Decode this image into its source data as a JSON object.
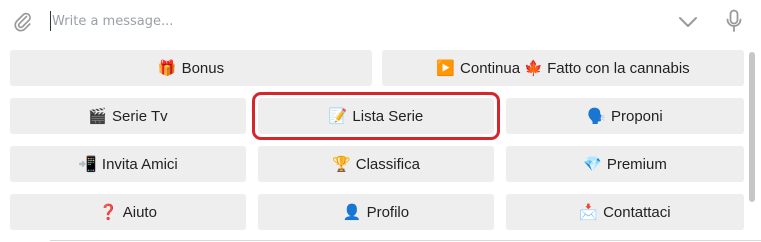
{
  "composer": {
    "placeholder": "Write a message...",
    "value": "",
    "attach_icon": "paperclip-icon",
    "collapse_icon": "chevron-down-icon",
    "mic_icon": "microphone-icon"
  },
  "keyboard": {
    "rows": [
      [
        {
          "emoji": "🎁",
          "label": "Bonus"
        },
        {
          "emoji": "▶️",
          "label": "Continua 🍁 Fatto con la cannabis"
        }
      ],
      [
        {
          "emoji": "🎬",
          "label": "Serie Tv"
        },
        {
          "emoji": "📝",
          "label": "Lista Serie"
        },
        {
          "emoji": "🗣️",
          "label": "Proponi"
        }
      ],
      [
        {
          "emoji": "📲",
          "label": "Invita Amici"
        },
        {
          "emoji": "🏆",
          "label": "Classifica"
        },
        {
          "emoji": "💎",
          "label": "Premium"
        }
      ],
      [
        {
          "emoji": "❓",
          "label": "Aiuto"
        },
        {
          "emoji": "👤",
          "label": "Profilo"
        },
        {
          "emoji": "📩",
          "label": "Contattaci"
        }
      ]
    ],
    "highlighted": "Lista Serie"
  },
  "colors": {
    "button_bg": "#eeeeee",
    "highlight": "#d8242b",
    "text": "#222222",
    "placeholder": "#9aa0a6"
  }
}
